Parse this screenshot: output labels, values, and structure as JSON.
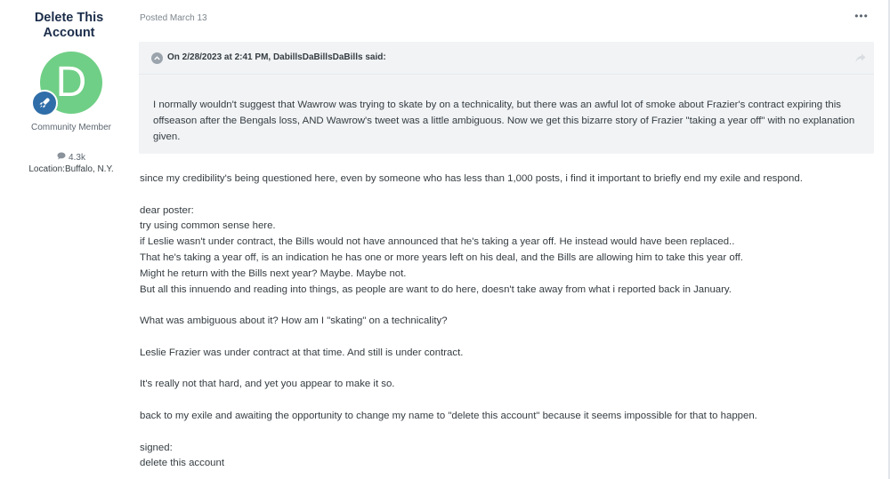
{
  "author": {
    "name": "Delete This Account",
    "avatar_letter": "D",
    "avatar_color": "#6fcf86",
    "rank_badge_icon": "rocket-icon",
    "member_title": "Community Member",
    "post_count": "4.3k",
    "post_count_icon": "comment-icon",
    "location_label": "Location:",
    "location": "Buffalo, N.Y."
  },
  "post": {
    "posted": "Posted March 13",
    "more_options": "•••",
    "quote": {
      "citation": "On 2/28/2023 at 2:41 PM, DabillsDaBillsDaBills said:",
      "body": "I normally wouldn't suggest that Wawrow was trying to skate by on a technicality, but there was an awful lot of smoke about Frazier's contract expiring this offseason after the Bengals loss, AND Wawrow's tweet was a little ambiguous. Now we get this bizarre story of Frazier \"taking a year off\" with no explanation given."
    },
    "lines": [
      "since my credibility's being questioned here, even by someone who has less  than 1,000 posts, i find it important to briefly end my exile and respond.",
      "",
      "dear poster:",
      "try using common sense here.",
      "if Leslie wasn't under contract, the Bills would not have announced that he's taking a year off. He instead would have been replaced..",
      "That he's taking a year off, is an indication he has one or more years left on his deal, and the Bills are allowing  him to take this year off.",
      "Might he return with the Bills next year? Maybe. Maybe not.",
      "But all this innuendo and reading into things, as people are want to do here, doesn't take away from what i reported back in January.",
      "",
      "What was ambiguous about it? How am I \"skating\" on a technicality?",
      "",
      "Leslie Frazier was under contract at that time. And still is under contract.",
      "",
      "It's really not that hard, and yet you appear to make it so.",
      "",
      "back to my exile and awaiting the opportunity to change my name to \"delete this account\" because it seems impossible for that to happen.",
      "",
      "signed:",
      "delete this account"
    ]
  }
}
